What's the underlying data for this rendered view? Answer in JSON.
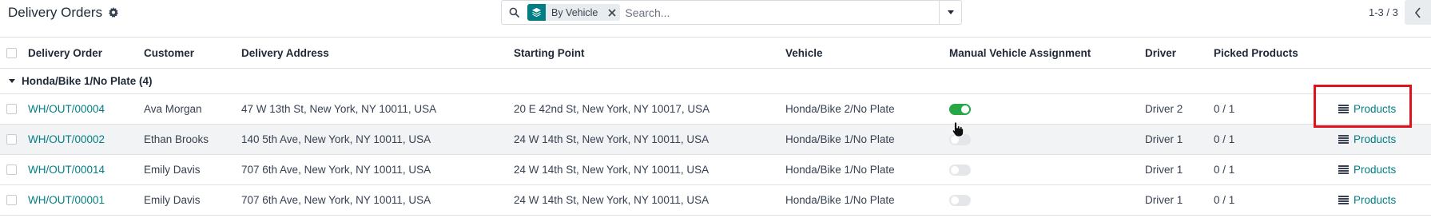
{
  "control_panel": {
    "title": "Delivery Orders",
    "settings_icon": "gear-icon",
    "search": {
      "facet_label": "By Vehicle",
      "facet_icon": "layers-icon",
      "placeholder": "Search..."
    },
    "pager": {
      "value": "1-3 / 3"
    }
  },
  "table": {
    "columns": [
      "Delivery Order",
      "Customer",
      "Delivery Address",
      "Starting Point",
      "Vehicle",
      "Manual Vehicle Assignment",
      "Driver",
      "Picked Products"
    ],
    "group": {
      "label": "Honda/Bike 1/No Plate (4)"
    },
    "rows": [
      {
        "order": "WH/OUT/00004",
        "customer": "Ava Morgan",
        "address": "47 W 13th St, New York, NY 10011, USA",
        "start": "20 E 42nd St, New York, NY 10017, USA",
        "vehicle": "Honda/Bike 2/No Plate",
        "manual_assignment": true,
        "driver": "Driver 2",
        "picked": "0 / 1",
        "action": "Products"
      },
      {
        "order": "WH/OUT/00002",
        "customer": "Ethan Brooks",
        "address": "140 5th Ave, New York, NY 10011, USA",
        "start": "24 W 14th St, New York, NY 10011, USA",
        "vehicle": "Honda/Bike 1/No Plate",
        "manual_assignment": false,
        "driver": "Driver 1",
        "picked": "0 / 1",
        "action": "Products"
      },
      {
        "order": "WH/OUT/00014",
        "customer": "Emily Davis",
        "address": "707 6th Ave, New York, NY 10011, USA",
        "start": "24 W 14th St, New York, NY 10011, USA",
        "vehicle": "Honda/Bike 1/No Plate",
        "manual_assignment": false,
        "driver": "Driver 1",
        "picked": "0 / 1",
        "action": "Products"
      },
      {
        "order": "WH/OUT/00001",
        "customer": "Emily Davis",
        "address": "707 6th Ave, New York, NY 10011, USA",
        "start": "24 W 14th St, New York, NY 10011, USA",
        "vehicle": "Honda/Bike 1/No Plate",
        "manual_assignment": false,
        "driver": "Driver 1",
        "picked": "0 / 1",
        "action": "Products"
      }
    ]
  },
  "colors": {
    "accent": "#017e84",
    "toggle_on": "#28a745",
    "highlight": "#e0121b"
  }
}
